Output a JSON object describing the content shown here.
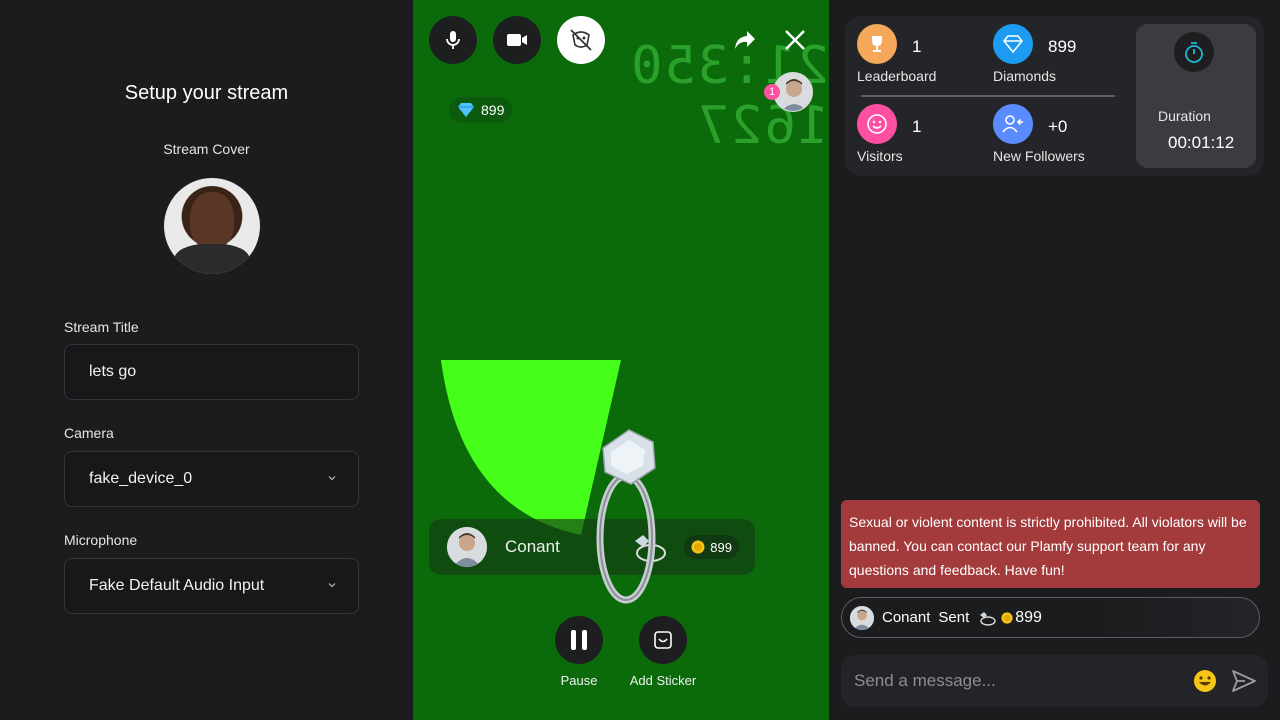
{
  "setup": {
    "title": "Setup your stream",
    "cover_label": "Stream Cover",
    "stream_title_label": "Stream Title",
    "stream_title_value": "lets go",
    "camera_label": "Camera",
    "camera_value": "fake_device_0",
    "microphone_label": "Microphone",
    "microphone_value": "Fake Default Audio Input"
  },
  "video": {
    "clock_text": "21:350 1627",
    "diamonds": "899",
    "viewer_count": "1",
    "gift": {
      "sender": "Conant",
      "coins": "899"
    },
    "controls": {
      "pause_label": "Pause",
      "sticker_label": "Add Sticker"
    }
  },
  "stats": {
    "leaderboard_value": "1",
    "leaderboard_label": "Leaderboard",
    "diamonds_value": "899",
    "diamonds_label": "Diamonds",
    "visitors_value": "1",
    "visitors_label": "Visitors",
    "followers_value": "+0",
    "followers_label": "New Followers",
    "duration_label": "Duration",
    "duration_value": "00:01:12"
  },
  "chat": {
    "notice": "Sexual or violent content is strictly prohibited. All violators will be banned. You can contact our Plamfy support team for any questions and feedback. Have fun!",
    "message": {
      "sender": "Conant",
      "verb": "Sent",
      "coins": "899"
    },
    "composer_placeholder": "Send a message..."
  },
  "colors": {
    "video_bg": "#0b6b0b",
    "notice_bg": "#a33a3c",
    "leaderboard": "#f5a75a",
    "diamonds": "#1d9bf0",
    "visitors": "#ff4fa3",
    "followers": "#5b8cff",
    "duration_accent": "#1fb6d6"
  }
}
